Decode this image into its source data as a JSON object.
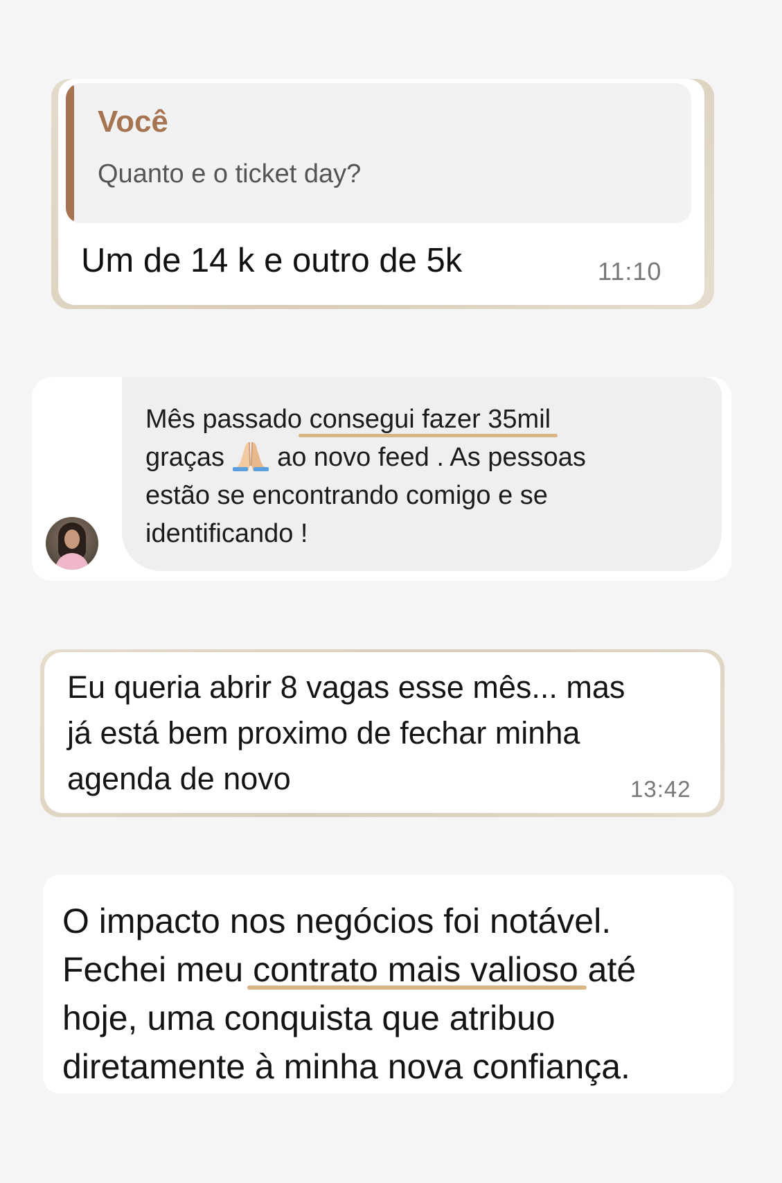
{
  "whatsapp_reply": {
    "quote_author": "Você",
    "quote_text": "Quanto e o ticket day?",
    "message": "Um de 14 k e outro de 5k",
    "time": "11:10"
  },
  "instagram_dm": {
    "line1_before": "Mês passado ",
    "line1_highlight": "consegui fazer 35mil",
    "line2_before": "graças",
    "line2_icon": "folded-hands-icon",
    "line2_after": "ao novo feed . As pessoas",
    "line3": "estão se encontrando comigo e se",
    "line4": "identificando !"
  },
  "whatsapp_message": {
    "line1": "Eu queria abrir 8 vagas esse mês... mas",
    "line2": "já está bem proximo de fechar minha",
    "line3": "agenda de novo",
    "time": "13:42"
  },
  "testimonial": {
    "line1": "O impacto nos negócios foi notável.",
    "line2_before": "Fechei meu ",
    "line2_highlight": "contrato mais valioso",
    "line2_after": " até",
    "line3": "hoje, uma conquista que atribuo",
    "line4": "diretamente à minha nova confiança."
  },
  "colors": {
    "accent_brown": "#a67452",
    "highlight_underline": "#d8b582",
    "page_background": "#f5f5f5"
  }
}
